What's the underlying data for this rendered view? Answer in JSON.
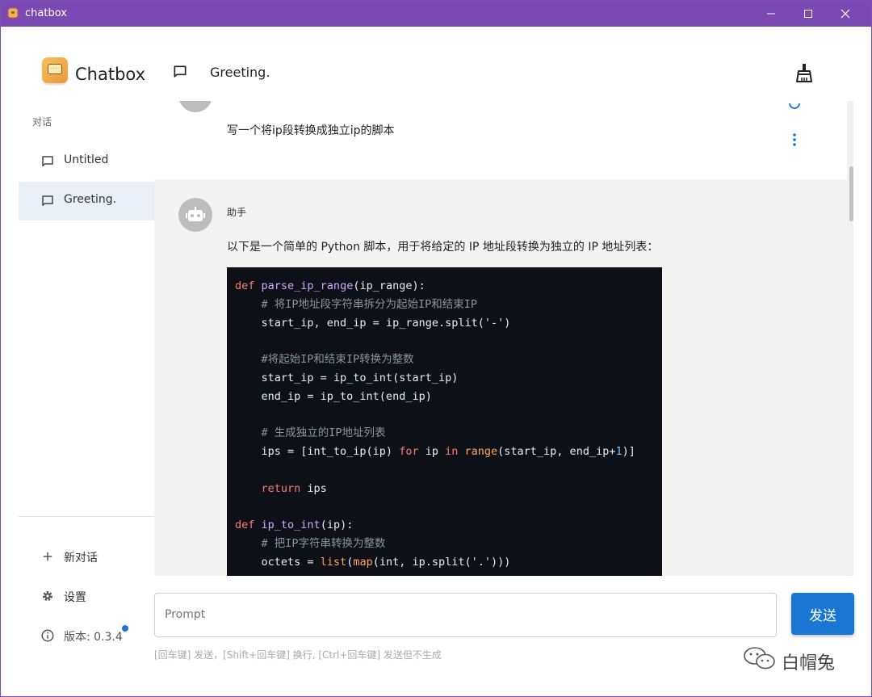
{
  "window": {
    "title": "chatbox"
  },
  "sidebar": {
    "brand": "Chatbox",
    "section_label": "对话",
    "conversations": [
      {
        "label": "Untitled",
        "active": false
      },
      {
        "label": "Greeting.",
        "active": true
      }
    ],
    "new_chat_label": "新对话",
    "settings_label": "设置",
    "version_label": "版本: 0.3.4"
  },
  "header": {
    "title": "Greeting."
  },
  "messages": {
    "user": {
      "text": "写一个将ip段转换成独立ip的脚本"
    },
    "assistant": {
      "name": "助手",
      "text": "以下是一个简单的 Python 脚本，用于将给定的 IP 地址段转换为独立的 IP 地址列表：",
      "code_lines": [
        "def parse_ip_range(ip_range):",
        "    # 将IP地址段字符串拆分为起始IP和结束IP",
        "    start_ip, end_ip = ip_range.split('-')",
        "",
        "    #将起始IP和结束IP转换为整数",
        "    start_ip = ip_to_int(start_ip)",
        "    end_ip = ip_to_int(end_ip)",
        "",
        "    # 生成独立的IP地址列表",
        "    ips = [int_to_ip(ip) for ip in range(start_ip, end_ip+1)]",
        "",
        "    return ips",
        "",
        "def ip_to_int(ip):",
        "    # 把IP字符串转换为整数",
        "    octets = list(map(int, ip.split('.')))"
      ]
    }
  },
  "input": {
    "placeholder": "Prompt",
    "send_label": "发送",
    "hint": "[回车键] 发送，[Shift+回车键] 换行, [Ctrl+回车键] 发送但不生成"
  },
  "watermark": {
    "text": "白帽兔"
  },
  "icons": {
    "app": "chatbox-app-icon",
    "chat": "chat-bubble-icon",
    "clean": "broom-icon",
    "add": "plus-icon",
    "settings": "gear-icon",
    "info": "info-icon",
    "more": "more-vertical-icon",
    "loading": "loading-spinner-icon",
    "assistant": "robot-icon"
  },
  "colors": {
    "titlebar": "#7a49b1",
    "accent": "#1976d2",
    "active_conversation": "#e9f0f8",
    "code_bg": "#0d1117"
  }
}
